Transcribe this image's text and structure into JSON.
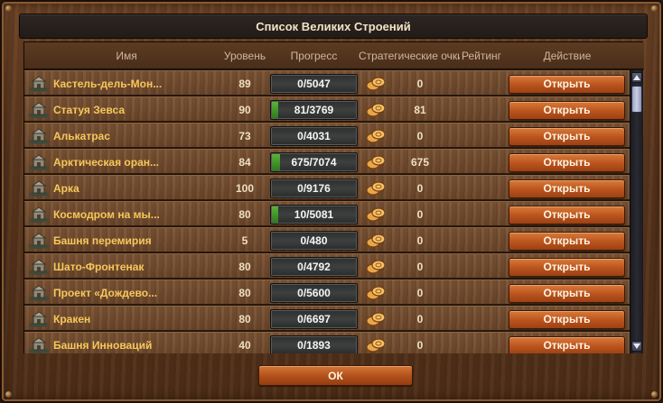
{
  "window": {
    "title": "Список Великих Строений"
  },
  "columns": {
    "name": "Имя",
    "level": "Уровень",
    "progress": "Прогресс",
    "strategy_points": "Стратегические очки",
    "rank": "Рейтинг",
    "action": "Действие"
  },
  "open_label": "Открыть",
  "ok_label": "ОК",
  "colors": {
    "name_text": "#f6c85b",
    "button": "#b9531d",
    "progress_fill": "#3f9a28"
  },
  "rows": [
    {
      "name": "Кастель-дель-Мон...",
      "level": "89",
      "progress": "0/5047",
      "progress_value": 0,
      "progress_max": 5047,
      "sp": "0",
      "icon": "castle-building-icon"
    },
    {
      "name": "Статуя Зевса",
      "level": "90",
      "progress": "81/3769",
      "progress_value": 81,
      "progress_max": 3769,
      "sp": "81",
      "icon": "statue-building-icon"
    },
    {
      "name": "Алькатрас",
      "level": "73",
      "progress": "0/4031",
      "progress_value": 0,
      "progress_max": 4031,
      "sp": "0",
      "icon": "prison-building-icon"
    },
    {
      "name": "Арктическая оран...",
      "level": "84",
      "progress": "675/7074",
      "progress_value": 675,
      "progress_max": 7074,
      "sp": "675",
      "icon": "orangery-building-icon"
    },
    {
      "name": "Арка",
      "level": "100",
      "progress": "0/9176",
      "progress_value": 0,
      "progress_max": 9176,
      "sp": "0",
      "icon": "arch-building-icon"
    },
    {
      "name": "Космодром на мы...",
      "level": "80",
      "progress": "10/5081",
      "progress_value": 10,
      "progress_max": 5081,
      "sp": "0",
      "icon": "spaceport-building-icon"
    },
    {
      "name": "Башня перемирия",
      "level": "5",
      "progress": "0/480",
      "progress_value": 0,
      "progress_max": 480,
      "sp": "0",
      "icon": "tower-building-icon"
    },
    {
      "name": "Шато-Фронтенак",
      "level": "80",
      "progress": "0/4792",
      "progress_value": 0,
      "progress_max": 4792,
      "sp": "0",
      "icon": "chateau-building-icon"
    },
    {
      "name": "Проект «Дождево...",
      "level": "80",
      "progress": "0/5600",
      "progress_value": 0,
      "progress_max": 5600,
      "sp": "0",
      "icon": "rainforest-building-icon"
    },
    {
      "name": "Кракен",
      "level": "80",
      "progress": "0/6697",
      "progress_value": 0,
      "progress_max": 6697,
      "sp": "0",
      "icon": "kraken-building-icon"
    },
    {
      "name": "Башня Инноваций",
      "level": "40",
      "progress": "0/1893",
      "progress_value": 0,
      "progress_max": 1893,
      "sp": "0",
      "icon": "innovation-tower-building-icon"
    }
  ]
}
